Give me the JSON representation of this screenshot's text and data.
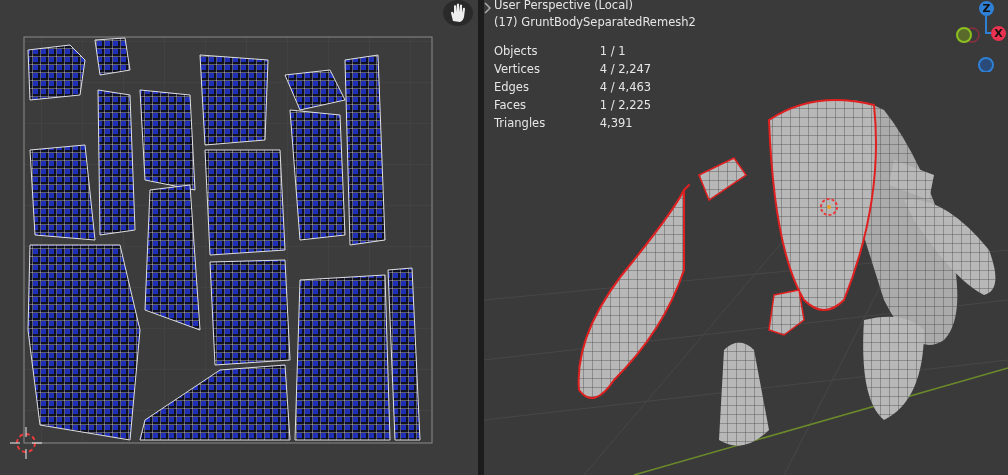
{
  "viewport": {
    "header_lines": [
      "User Perspective (Local)",
      "(17) GruntBodySeparatedRemesh2"
    ],
    "stats": [
      {
        "label": "Objects",
        "value": "1 / 1"
      },
      {
        "label": "Vertices",
        "value": "4 / 2,247"
      },
      {
        "label": "Edges",
        "value": "4 / 4,463"
      },
      {
        "label": "Faces",
        "value": "1 / 2,225"
      },
      {
        "label": "Triangles",
        "value": "4,391"
      }
    ],
    "gizmo_axes": [
      {
        "label": "Z",
        "color": "#2f7fd4"
      },
      {
        "label": "X",
        "color": "#e8324f"
      }
    ]
  }
}
